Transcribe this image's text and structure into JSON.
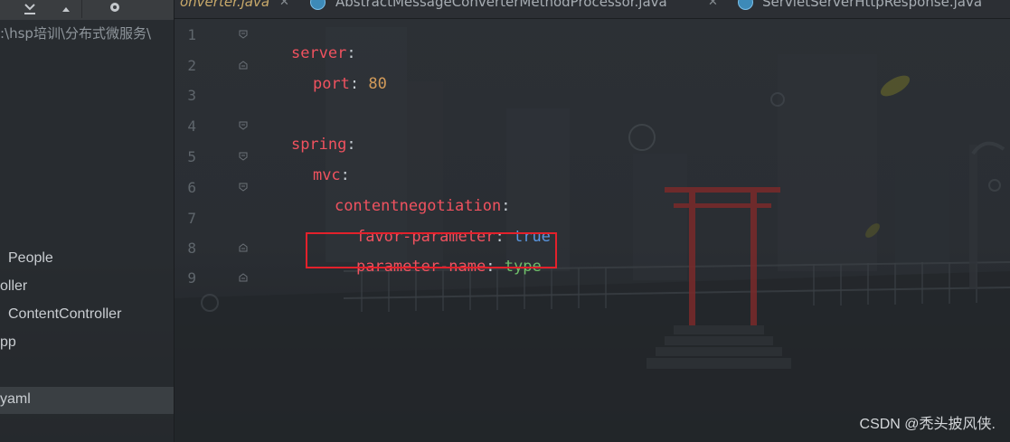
{
  "panel": {
    "path": ":\\hsp培训\\分布式微服务\\",
    "tree_items": [
      "People",
      "oller",
      "ContentController",
      "pp"
    ],
    "selected_item": "yaml"
  },
  "tabs": [
    {
      "label": "onverter.java",
      "italic": true
    },
    {
      "label": "AbstractMessageConverterMethodProcessor.java"
    },
    {
      "label": "ServletServerHttpResponse.java"
    }
  ],
  "editor": {
    "line_numbers": [
      "1",
      "2",
      "3",
      "4",
      "5",
      "6",
      "7",
      "8",
      "9"
    ],
    "lines": [
      {
        "key": "server",
        "sep": ":",
        "value": ""
      },
      {
        "key": "port",
        "sep": ": ",
        "value": "80"
      },
      {
        "key": "",
        "sep": "",
        "value": ""
      },
      {
        "key": "spring",
        "sep": ":",
        "value": ""
      },
      {
        "key": "mvc",
        "sep": ":",
        "value": ""
      },
      {
        "key": "contentnegotiation",
        "sep": ":",
        "value": ""
      },
      {
        "key": "favor-parameter",
        "sep": ": ",
        "value": "true"
      },
      {
        "key": "parameter-name",
        "sep": ": ",
        "value": "type"
      },
      {
        "key": "",
        "sep": "",
        "value": ""
      }
    ]
  },
  "watermark": "CSDN @秃头披风侠.",
  "colors": {
    "key": "#f0525f",
    "number": "#d39b5a",
    "boolean": "#5b97e0",
    "string": "#6fbf6a",
    "highlight_border": "#e3212b"
  },
  "icons": [
    "collapse-all-icon",
    "up-arrow-icon",
    "gear-icon",
    "class-icon",
    "close-icon",
    "fold-marker-icon"
  ]
}
